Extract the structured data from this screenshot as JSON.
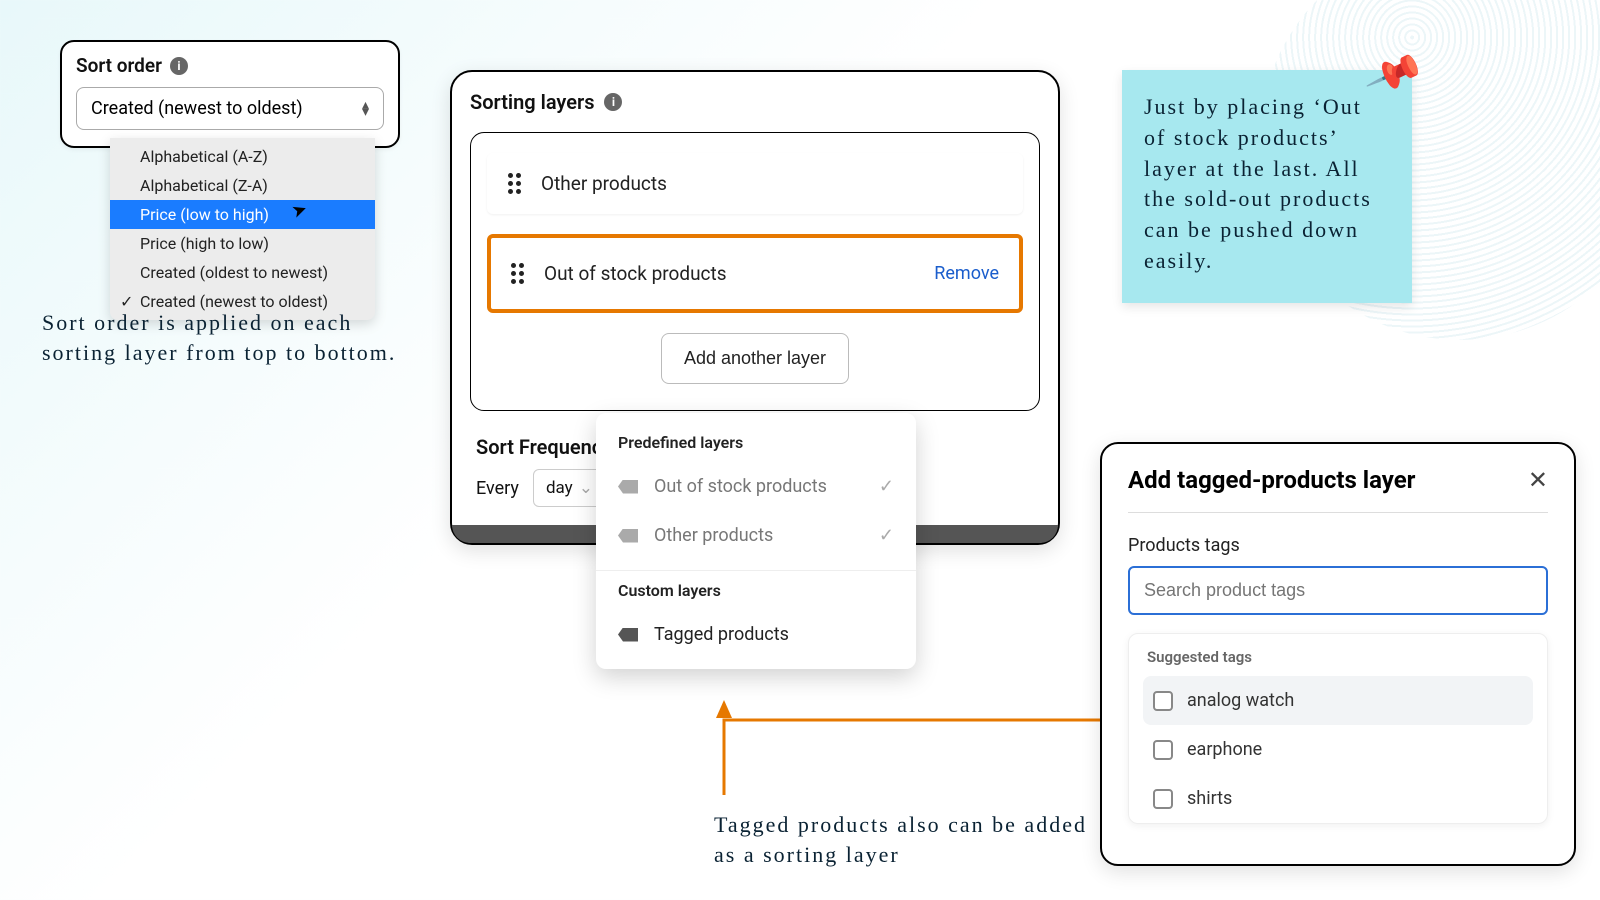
{
  "sort_order": {
    "label": "Sort order",
    "selected": "Created (newest to oldest)",
    "options": [
      "Alphabetical (A-Z)",
      "Alphabetical (Z-A)",
      "Price (low to high)",
      "Price (high to low)",
      "Created (oldest to newest)",
      "Created (newest to oldest)"
    ],
    "highlighted_index": 2,
    "checked_index": 5
  },
  "annotations": {
    "sort": "Sort order is applied on each sorting layer from top to bottom.",
    "tagged": "Tagged products also can be added as a sorting layer",
    "sticky": "Just by placing ‘Out of stock products’ layer at the last. All the sold-out products can be pushed down easily."
  },
  "sorting_layers": {
    "title": "Sorting layers",
    "layers": [
      {
        "name": "Other products",
        "removable": false
      },
      {
        "name": "Out of stock products",
        "removable": true,
        "remove_label": "Remove"
      }
    ],
    "add_button": "Add another layer",
    "sort_freq_label": "Sort Frequency",
    "every_label": "Every",
    "freq_value": "day"
  },
  "layer_popover": {
    "predefined_title": "Predefined layers",
    "predefined": [
      {
        "label": "Out of stock products",
        "checked": true
      },
      {
        "label": "Other products",
        "checked": true
      }
    ],
    "custom_title": "Custom layers",
    "custom": [
      {
        "label": "Tagged products"
      }
    ]
  },
  "modal": {
    "title": "Add tagged-products layer",
    "field_label": "Products tags",
    "placeholder": "Search product tags",
    "suggested_title": "Suggested tags",
    "tags": [
      "analog watch",
      "earphone",
      "shirts"
    ]
  },
  "colors": {
    "highlight_orange": "#e67800",
    "link_blue": "#1a5dcc",
    "focus_blue": "#2b6fd6",
    "sticky_bg": "#a7e8ef"
  }
}
